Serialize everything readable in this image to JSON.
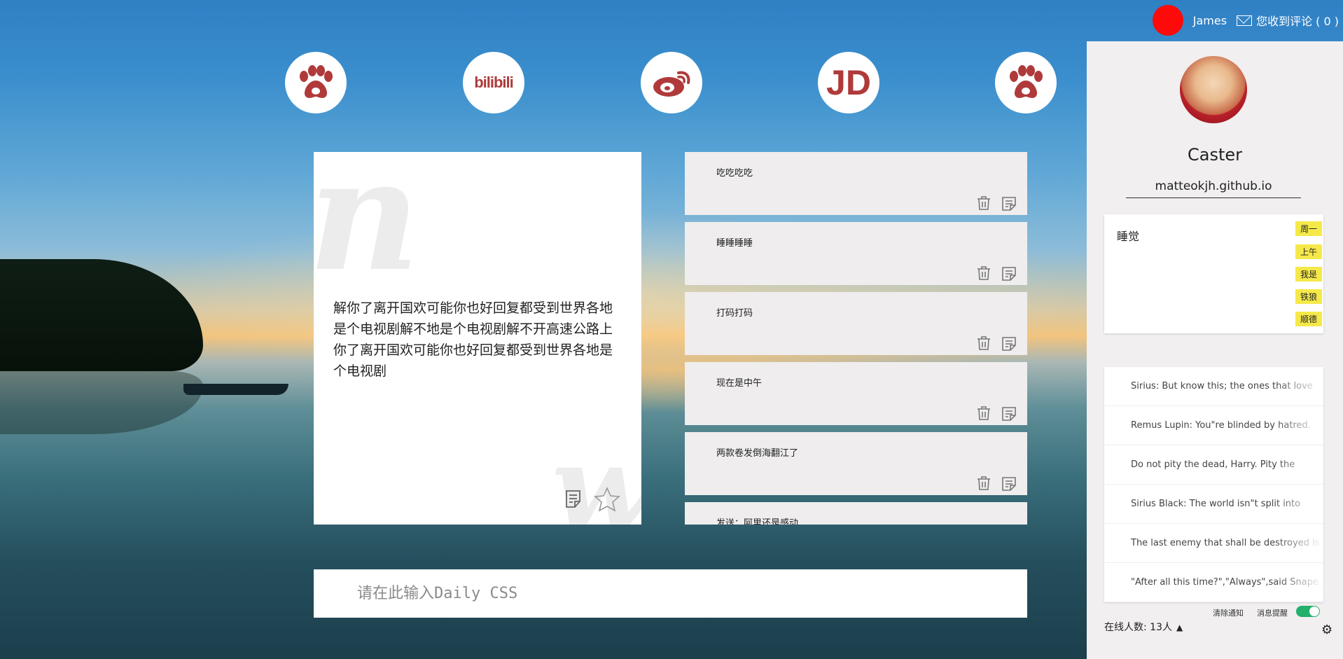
{
  "topbar": {
    "user_name": "James",
    "comments_label": "您收到评论 ( 0 )"
  },
  "shortcuts": [
    {
      "name": "baidu",
      "icon": "paw-icon"
    },
    {
      "name": "bilibili",
      "icon": "bilibili-icon",
      "text": "bilibili"
    },
    {
      "name": "weibo",
      "icon": "weibo-icon"
    },
    {
      "name": "jd",
      "icon": "jd-icon",
      "text": "JD"
    },
    {
      "name": "baidu-2",
      "icon": "paw-icon"
    }
  ],
  "note": {
    "text": "解你了离开国欢可能你也好回复都受到世界各地是个电视剧解不地是个电视剧解不开高速公路上你了离开国欢可能你也好回复都受到世界各地是个电视剧"
  },
  "list": [
    {
      "title": "吃吃吃吃"
    },
    {
      "title": "睡睡睡睡"
    },
    {
      "title": "打码打码"
    },
    {
      "title": "现在是中午"
    },
    {
      "title": "两款卷发倒海翻江了"
    },
    {
      "title": "发送：阿里还是感动"
    }
  ],
  "input": {
    "placeholder": "请在此输入Daily CSS"
  },
  "panel": {
    "name": "Caster",
    "site": "matteokjh.github.io",
    "memo": {
      "text": "睡觉",
      "tags": [
        "周一",
        "上午",
        "我是",
        "铁狼",
        "顺德"
      ]
    },
    "quotes": [
      "Sirius: But know this; the ones that love",
      "Remus Lupin: You\"re blinded by hatred.",
      "Do not pity the dead, Harry. Pity the",
      "Sirius Black: The world isn\"t split into",
      "The last enemy that shall be destroyed is",
      "\"After all this time?\",\"Always\",said Snape."
    ],
    "clear_label": "清除通知",
    "remind_label": "消息提醒",
    "remind_on": true,
    "online_label": "在线人数: 13人"
  },
  "colors": {
    "accent_red": "#ff0a0a",
    "icon_red": "#b03a3a",
    "toggle_green": "#23b06a",
    "tag_yellow": "#f5e94a"
  }
}
